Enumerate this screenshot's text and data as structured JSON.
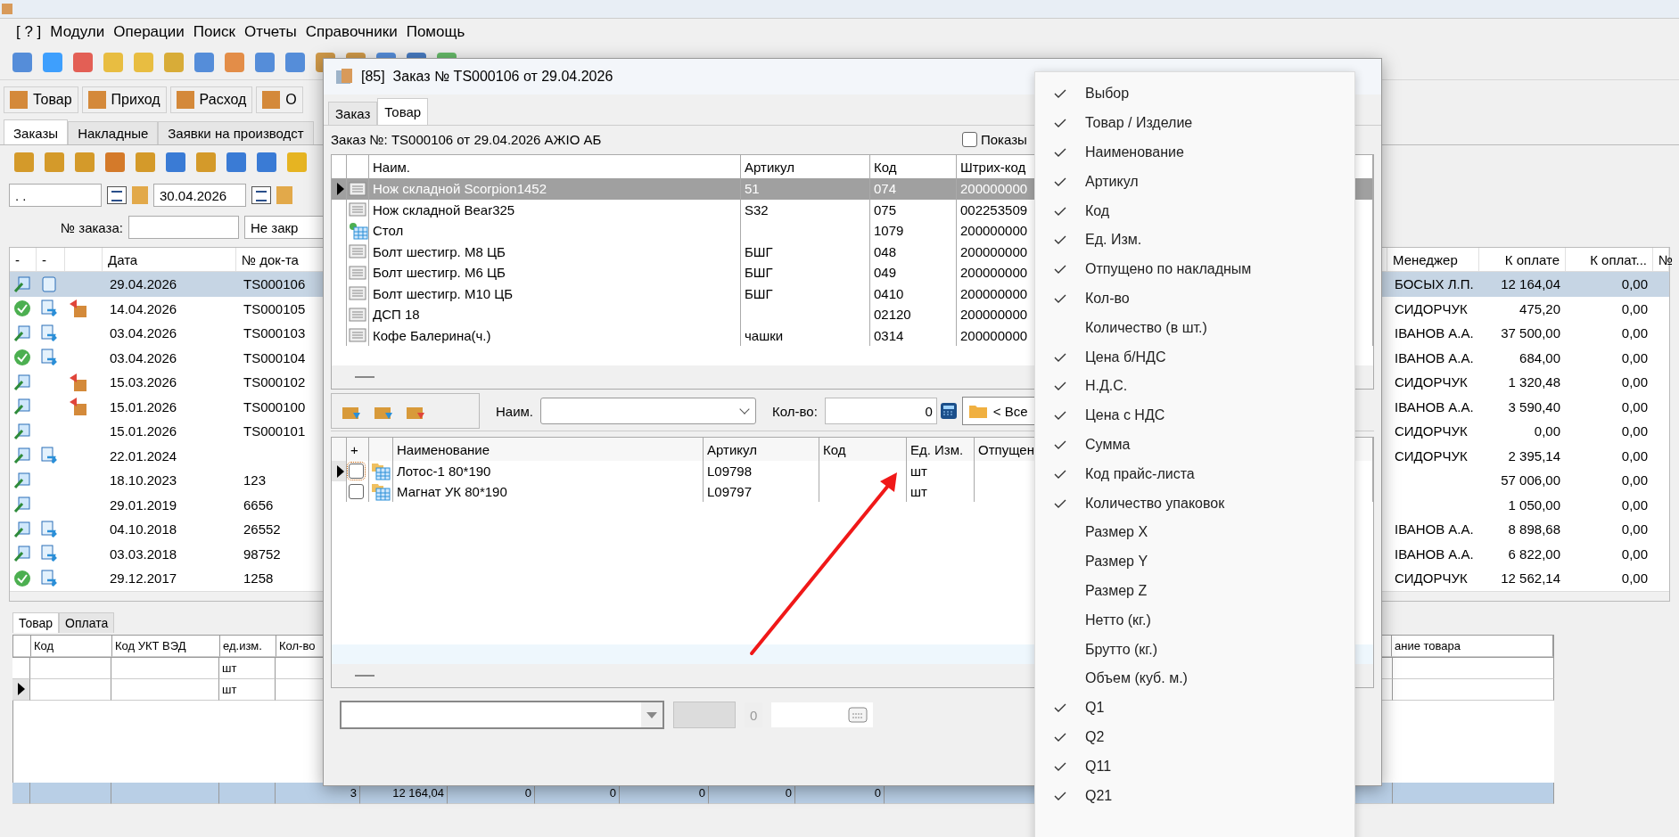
{
  "menu_bar": [
    "[ ? ]",
    "Модули",
    "Операции",
    "Поиск",
    "Отчеты",
    "Справочники",
    "Помощь"
  ],
  "quick_buttons": [
    {
      "label": "Товар"
    },
    {
      "label": "Приход"
    },
    {
      "label": "Расход"
    },
    {
      "label": "О"
    }
  ],
  "tabs": [
    {
      "label": "Заказы",
      "selected": true
    },
    {
      "label": "Накладные",
      "selected": false
    },
    {
      "label": "Заявки на производст",
      "selected": false
    }
  ],
  "filters": {
    "date_from": ". .",
    "date_to": "30.04.2026",
    "order_no_label": "№ заказа:",
    "status_value": "Не закр"
  },
  "orders": {
    "columns": [
      "-",
      "-",
      "Дата",
      "№ док-та",
      "Менеджер",
      "К оплате",
      "К оплат...",
      "№"
    ],
    "rows": [
      {
        "done": false,
        "doc_note": true,
        "doc_transfer": false,
        "shipped": false,
        "date": "29.04.2026",
        "number": "TS000106",
        "manager": "БОСЫХ Л.П.",
        "to_pay": "12 164,04",
        "to_pay_2": "0,00",
        "selected": true
      },
      {
        "done": true,
        "doc_note": false,
        "doc_transfer": true,
        "shipped": true,
        "date": "14.04.2026",
        "number": "TS000105",
        "manager": "СИДОРЧУК",
        "to_pay": "475,20",
        "to_pay_2": "0,00",
        "selected": false
      },
      {
        "done": false,
        "doc_note": false,
        "doc_transfer": true,
        "shipped": false,
        "date": "03.04.2026",
        "number": "TS000103",
        "manager": "IВАНОВ А.А.",
        "to_pay": "37 500,00",
        "to_pay_2": "0,00",
        "selected": false
      },
      {
        "done": true,
        "doc_note": false,
        "doc_transfer": true,
        "shipped": false,
        "date": "03.04.2026",
        "number": "TS000104",
        "manager": "IВАНОВ А.А.",
        "to_pay": "684,00",
        "to_pay_2": "0,00",
        "selected": false
      },
      {
        "done": false,
        "doc_note": false,
        "doc_transfer": false,
        "shipped": true,
        "date": "15.03.2026",
        "number": "TS000102",
        "manager": "СИДОРЧУК",
        "to_pay": "1 320,48",
        "to_pay_2": "0,00",
        "selected": false
      },
      {
        "done": false,
        "doc_note": false,
        "doc_transfer": false,
        "shipped": true,
        "date": "15.01.2026",
        "number": "TS000100",
        "manager": "IВАНОВ А.А.",
        "to_pay": "3 590,40",
        "to_pay_2": "0,00",
        "selected": false
      },
      {
        "done": false,
        "doc_note": false,
        "doc_transfer": false,
        "shipped": false,
        "date": "15.01.2026",
        "number": "TS000101",
        "manager": "СИДОРЧУК",
        "to_pay": "0,00",
        "to_pay_2": "0,00",
        "selected": false
      },
      {
        "done": false,
        "doc_note": false,
        "doc_transfer": true,
        "shipped": false,
        "date": "22.01.2024",
        "manager": "СИДОРЧУК",
        "to_pay": "2 395,14",
        "to_pay_2": "0,00",
        "selected": false
      },
      {
        "done": false,
        "doc_note": false,
        "doc_transfer": false,
        "shipped": false,
        "date": "18.10.2023",
        "number": "123",
        "to_pay": "57 006,00",
        "to_pay_2": "0,00",
        "selected": false
      },
      {
        "done": false,
        "doc_note": false,
        "doc_transfer": false,
        "shipped": false,
        "date": "29.01.2019",
        "number": "6656",
        "to_pay": "1 050,00",
        "to_pay_2": "0,00",
        "selected": false
      },
      {
        "done": false,
        "doc_note": false,
        "doc_transfer": true,
        "shipped": false,
        "date": "04.10.2018",
        "number": "26552",
        "manager": "IВАНОВ А.А.",
        "to_pay": "8 898,68",
        "to_pay_2": "0,00",
        "selected": false
      },
      {
        "done": false,
        "doc_note": false,
        "doc_transfer": true,
        "shipped": false,
        "date": "03.03.2018",
        "number": "98752",
        "manager": "IВАНОВ А.А.",
        "to_pay": "6 822,00",
        "to_pay_2": "0,00",
        "selected": false
      },
      {
        "done": true,
        "doc_note": false,
        "doc_transfer": true,
        "shipped": false,
        "date": "29.12.2017",
        "number": "1258",
        "manager": "СИДОРЧУК",
        "to_pay": "12 562,14",
        "to_pay_2": "0,00",
        "selected": false
      }
    ]
  },
  "bottom": {
    "tabs": [
      {
        "label": "Товар",
        "selected": true
      },
      {
        "label": "Оплата",
        "selected": false
      }
    ],
    "columns": [
      "Код",
      "Код УКТ ВЭД",
      "ед.изм.",
      "Кол-во",
      "ание товара"
    ],
    "rows": [
      {
        "unit": "шт",
        "selected": false
      },
      {
        "unit": "шт",
        "selected": true
      }
    ],
    "totals": [
      "3",
      "12 164,04",
      "0",
      "0",
      "0",
      "0",
      "0"
    ]
  },
  "dialog": {
    "number": "[85]",
    "title": "Заказ № TS000106 от 29.04.2026",
    "tabs": [
      {
        "label": "Заказ",
        "selected": false
      },
      {
        "label": "Товар",
        "selected": true
      }
    ],
    "order_label": "Заказ №: TS000106 от 29.04.2026 АЖIO АБ",
    "show_checkbox": {
      "label": "Показы",
      "checked": false
    },
    "items": {
      "columns": [
        "Наим.",
        "Артикул",
        "Код",
        "Штрих-код"
      ],
      "rows": [
        {
          "kind": "item",
          "name": "Нож складной Scorpion1452",
          "article": "51",
          "code": "074",
          "barcode": "200000000",
          "selected": true
        },
        {
          "kind": "item",
          "name": "Нож складной Bear325",
          "article": "S32",
          "code": "075",
          "barcode": "002253509",
          "selected": false
        },
        {
          "kind": "product",
          "name": "Стол",
          "code": "1079",
          "barcode": "200000000",
          "selected": false
        },
        {
          "kind": "item",
          "name": "Болт шестигр. М8 ЦБ",
          "article": "БШГ",
          "code": "048",
          "barcode": "200000000",
          "selected": false
        },
        {
          "kind": "item",
          "name": "Болт шестигр. М6 ЦБ",
          "article": "БШГ",
          "code": "049",
          "barcode": "200000000",
          "selected": false
        },
        {
          "kind": "item",
          "name": "Болт шестигр. М10 ЦБ",
          "article": "БШГ",
          "code": "0410",
          "barcode": "200000000",
          "selected": false
        },
        {
          "kind": "item",
          "name": "ДСП 18",
          "code": "02120",
          "barcode": "200000000",
          "selected": false
        },
        {
          "kind": "item",
          "name": "Кофе Балерина(ч.)",
          "article": "чашки",
          "code": "0314",
          "barcode": "200000000",
          "selected": false
        }
      ]
    },
    "filter": {
      "name_label": "Наим.",
      "qty_label": "Кол-во:",
      "qty_value": "0",
      "group": "< Все"
    },
    "chosen": {
      "columns": [
        "+",
        "Наименование",
        "Артикул",
        "Код",
        "Ед. Изм.",
        "Отпущен"
      ],
      "rows": [
        {
          "name": "Лотос-1 80*190",
          "article": "L09798",
          "unit": "шт",
          "checked": false,
          "selected": true
        },
        {
          "name": "Магнат УК 80*190",
          "article": "L09797",
          "unit": "шт",
          "checked": false,
          "selected": false
        }
      ]
    },
    "spin_value": "0"
  },
  "column_menu": {
    "items": [
      {
        "label": "Выбор",
        "checked": true
      },
      {
        "label": "Товар / Изделие",
        "checked": true
      },
      {
        "label": "Наименование",
        "checked": true
      },
      {
        "label": "Артикул",
        "checked": true
      },
      {
        "label": "Код",
        "checked": true
      },
      {
        "label": "Ед. Изм.",
        "checked": true
      },
      {
        "label": "Отпущено по накладным",
        "checked": true
      },
      {
        "label": "Кол-во",
        "checked": true
      },
      {
        "label": "Количество (в шт.)",
        "checked": false
      },
      {
        "label": "Цена б/НДС",
        "checked": true
      },
      {
        "label": "Н.Д.С.",
        "checked": true
      },
      {
        "label": "Цена с НДС",
        "checked": true
      },
      {
        "label": "Сумма",
        "checked": true
      },
      {
        "label": "Код прайс-листа",
        "checked": true
      },
      {
        "label": "Количество упаковок",
        "checked": true
      },
      {
        "label": "Размер X",
        "checked": false
      },
      {
        "label": "Размер Y",
        "checked": false
      },
      {
        "label": "Размер Z",
        "checked": false
      },
      {
        "label": "Нетто (кг.)",
        "checked": false
      },
      {
        "label": "Брутто (кг.)",
        "checked": false
      },
      {
        "label": "Объем (куб. м.)",
        "checked": false
      },
      {
        "label": "Q1",
        "checked": true
      },
      {
        "label": "Q2",
        "checked": true
      },
      {
        "label": "Q11",
        "checked": true
      },
      {
        "label": "Q21",
        "checked": true
      }
    ]
  }
}
